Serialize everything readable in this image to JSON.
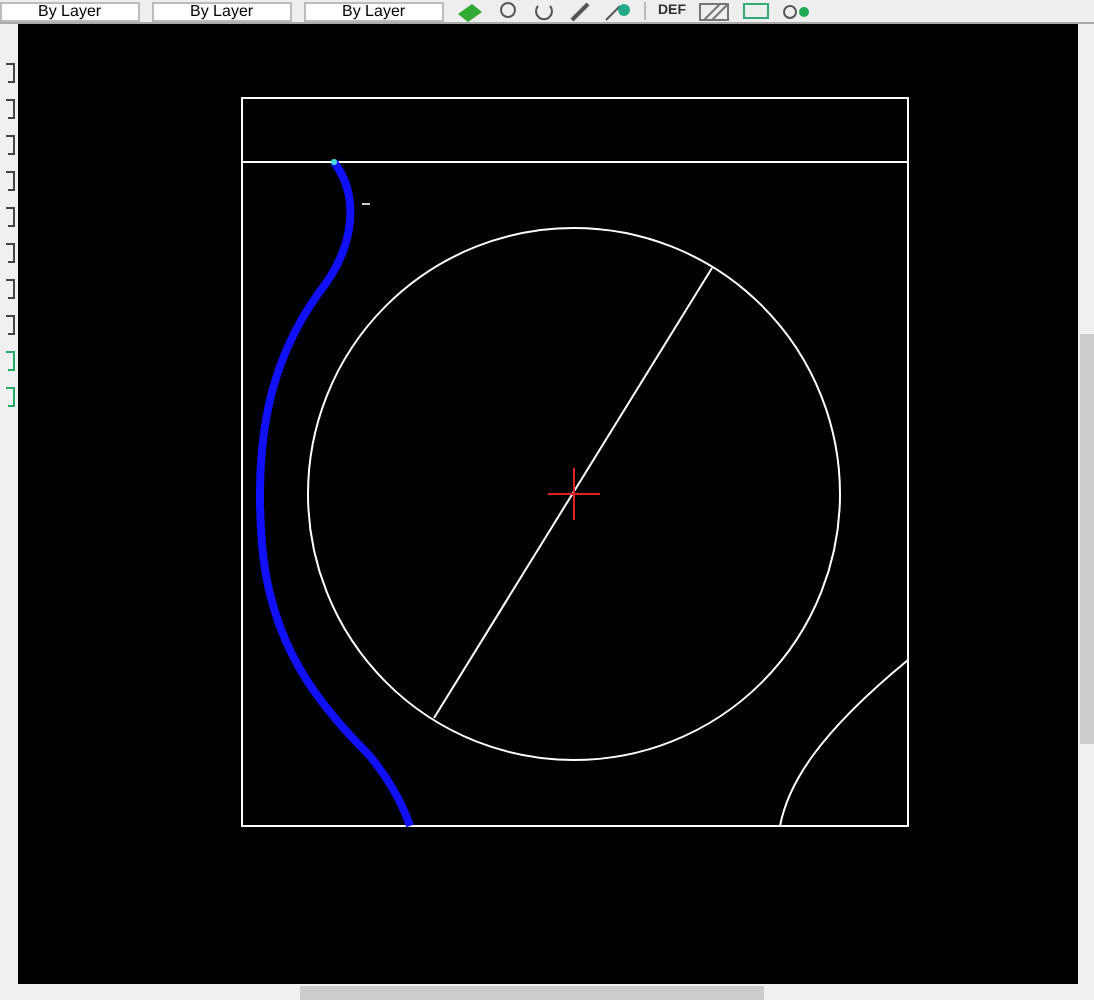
{
  "toolbar": {
    "dropdowns": [
      {
        "value": "By Layer"
      },
      {
        "value": "By Layer"
      },
      {
        "value": "By Layer"
      }
    ],
    "style_label": "DEF"
  }
}
